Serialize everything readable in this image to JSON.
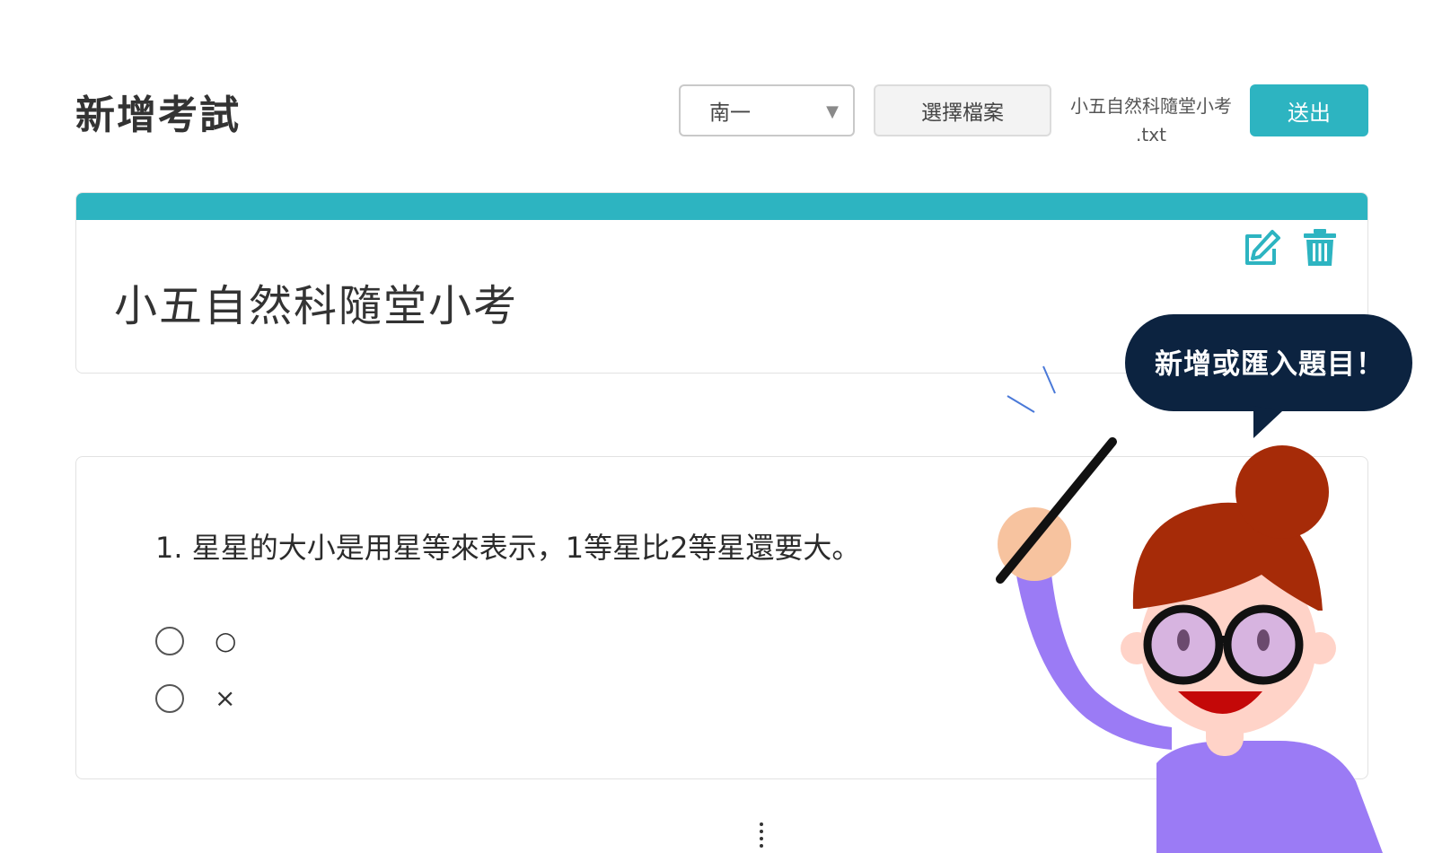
{
  "header": {
    "title": "新增考試",
    "publisher_select": {
      "selected": "南一",
      "caret": "▼"
    },
    "choose_file_label": "選擇檔案",
    "file_name_line1": "小五自然科隨堂小考",
    "file_name_line2": ".txt",
    "submit_label": "送出"
  },
  "exam": {
    "title": "小五自然科隨堂小考",
    "accent_color": "#2db4c1"
  },
  "question": {
    "text": "1. 星星的大小是用星等來表示，1等星比2等星還要大。",
    "options": [
      {
        "label": "○"
      },
      {
        "label": "×"
      }
    ]
  },
  "mascot": {
    "bubble_text": "新增或匯入題目！",
    "bubble_color": "#0c2340"
  },
  "icons": [
    "edit-icon",
    "trash-icon",
    "radio-icon",
    "drag-handle-icon"
  ]
}
